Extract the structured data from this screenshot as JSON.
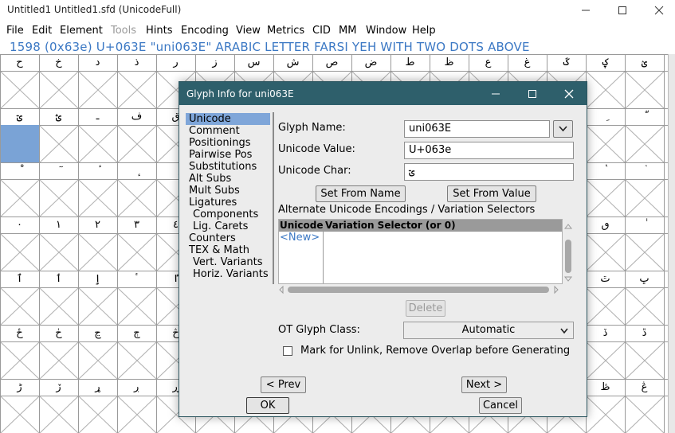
{
  "window": {
    "title": "Untitled1  Untitled1.sfd (UnicodeFull)",
    "minimize_icon": "minimize-icon",
    "maximize_icon": "maximize-icon",
    "close_icon": "close-icon"
  },
  "menubar": {
    "items": [
      "File",
      "Edit",
      "Element",
      "Tools",
      "Hints",
      "Encoding",
      "View",
      "Metrics",
      "CID",
      "MM",
      "Window",
      "Help"
    ]
  },
  "glyph_info_line": "1598 (0x63e) U+063E \"uni063E\" ARABIC LETTER FARSI YEH WITH TWO DOTS ABOVE",
  "grid": {
    "rows": [
      [
        "ح",
        "خ",
        "د",
        "ذ",
        "ر",
        "ز",
        "س",
        "ش",
        "ص",
        "ض",
        "ط",
        "ظ",
        "ع",
        "غ",
        "ػ",
        "ؼ",
        "ؽ"
      ],
      [
        "ؾ",
        "ؿ",
        "ـ",
        "ف",
        "ق",
        "",
        "",
        "",
        "",
        "",
        "",
        "",
        "",
        "",
        "",
        "ِ",
        "ّ"
      ],
      [
        "ْ",
        "ٓ",
        "ٔ",
        "ٕ",
        "ٖ",
        "",
        "",
        "",
        "",
        "",
        "",
        "",
        "",
        "",
        "",
        "ٝ",
        "ٞ"
      ],
      [
        "٠",
        "١",
        "٢",
        "٣",
        "٤",
        "",
        "",
        "",
        "",
        "",
        "",
        "",
        "",
        "",
        "",
        "ٯ",
        "ٰ"
      ],
      [
        "ٱ",
        "ٲ",
        "ٳ",
        "ٴ",
        "ٵ",
        "",
        "",
        "",
        "",
        "",
        "",
        "",
        "",
        "",
        "",
        "ٿ",
        "ڀ"
      ],
      [
        "ځ",
        "ڂ",
        "ڃ",
        "ڄ",
        "څ",
        "",
        "",
        "",
        "",
        "",
        "",
        "",
        "",
        "",
        "",
        "ڏ",
        "ڐ"
      ],
      [
        "ڑ",
        "ڒ",
        "ړ",
        "ڔ",
        "ڕ",
        "",
        "",
        "",
        "",
        "",
        "",
        "",
        "",
        "",
        "",
        "ڟ",
        "ڠ"
      ]
    ]
  },
  "dialog": {
    "title": "Glyph Info for uni063E",
    "minimize_icon": "minimize-icon",
    "maximize_icon": "maximize-icon",
    "close_icon": "close-icon",
    "side_items": [
      {
        "label": "Unicode",
        "indent": false,
        "active": true
      },
      {
        "label": "Comment",
        "indent": false,
        "active": false
      },
      {
        "label": "Positionings",
        "indent": false,
        "active": false
      },
      {
        "label": "Pairwise Pos",
        "indent": false,
        "active": false
      },
      {
        "label": "Substitutions",
        "indent": false,
        "active": false
      },
      {
        "label": "Alt Subs",
        "indent": false,
        "active": false
      },
      {
        "label": "Mult Subs",
        "indent": false,
        "active": false
      },
      {
        "label": "Ligatures",
        "indent": false,
        "active": false
      },
      {
        "label": "Components",
        "indent": true,
        "active": false
      },
      {
        "label": "Lig. Carets",
        "indent": true,
        "active": false
      },
      {
        "label": "Counters",
        "indent": false,
        "active": false
      },
      {
        "label": "TEX & Math",
        "indent": false,
        "active": false
      },
      {
        "label": "Vert. Variants",
        "indent": true,
        "active": false
      },
      {
        "label": "Horiz. Variants",
        "indent": true,
        "active": false
      }
    ],
    "glyph_name_label": "Glyph Name:",
    "glyph_name_value": "uni063E",
    "unicode_value_label": "Unicode Value:",
    "unicode_value": "U+063e",
    "unicode_char_label": "Unicode Char:",
    "unicode_char": "ؾ",
    "set_from_name": "Set From Name",
    "set_from_value": "Set From Value",
    "alt_title": "Alternate Unicode Encodings / Variation Selectors",
    "alt_col_unicode": "Unicode",
    "alt_col_selector": "Variation Selector (or 0)",
    "alt_new": "<New>",
    "delete": "Delete",
    "ot_class_label": "OT Glyph Class:",
    "ot_class_value": "Automatic",
    "unlink_label": "Mark for Unlink, Remove Overlap before Generating",
    "unlink_checked": false,
    "prev": "< Prev",
    "next": "Next >",
    "ok": "OK",
    "cancel": "Cancel"
  },
  "colors": {
    "dialog_titlebar": "#2e5f6b",
    "selection": "#7fa6d9",
    "info_text": "#3b78c4"
  }
}
